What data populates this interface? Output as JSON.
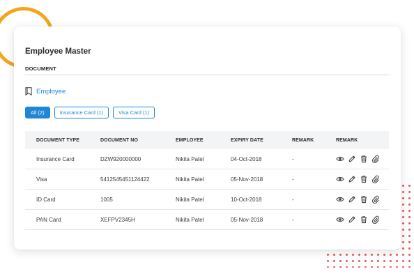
{
  "page": {
    "title": "Employee Master",
    "section_label": "DOCUMENT",
    "employee_link": "Employee"
  },
  "filters": [
    {
      "label": "All (2)",
      "active": true
    },
    {
      "label": "Insurance Card (1)",
      "active": false
    },
    {
      "label": "Visa Card (1)",
      "active": false
    }
  ],
  "table": {
    "headers": [
      "DOCUMENT TYPE",
      "DOCUMENT NO",
      "EMPLOYEE",
      "EXPIRY DATE",
      "REMARK",
      "REMARK"
    ],
    "rows": [
      {
        "type": "Insurance Card",
        "number": "DZW920000000",
        "employee": "Nikita Patel",
        "expiry": "04-Oct-2018",
        "remark": "-"
      },
      {
        "type": "Visa",
        "number": "5412545451124422",
        "employee": "Nikita Patel",
        "expiry": "05-Nov-2018",
        "remark": "-"
      },
      {
        "type": "ID Card",
        "number": "1005",
        "employee": "Nikita Patel",
        "expiry": "10-Oct-2018",
        "remark": "-"
      },
      {
        "type": "PAN Card",
        "number": "XEFPV2345H",
        "employee": "Nikita Patel",
        "expiry": "05-Nov-2018",
        "remark": "-"
      }
    ],
    "row_actions": [
      "eye-icon",
      "pencil-icon",
      "trash-icon",
      "paperclip-icon"
    ]
  },
  "colors": {
    "accent": "#1f86d6",
    "decor_arc": "#f4a51c",
    "decor_dots": "#ef5a5a"
  }
}
